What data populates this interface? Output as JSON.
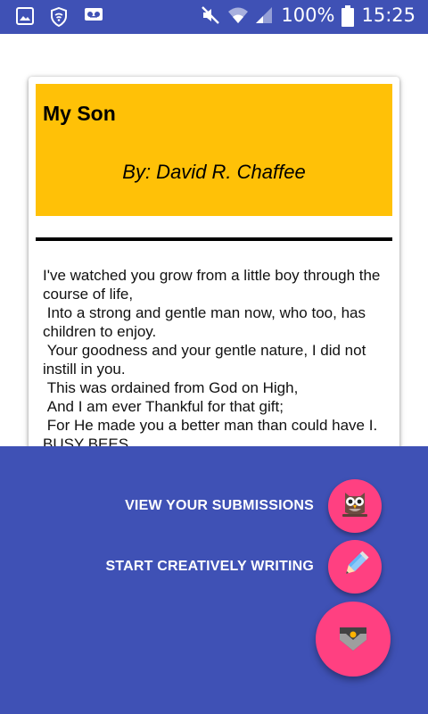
{
  "status_bar": {
    "battery_percent": "100%",
    "time": "15:25",
    "icons": [
      "image-icon",
      "vpn-shield-icon",
      "voicemail-icon",
      "mute-icon",
      "wifi-icon",
      "signal-icon",
      "battery-icon"
    ]
  },
  "poem": {
    "title": "My Son",
    "author": "By:  David R. Chaffee",
    "body": "I've watched you grow from a little boy through the course of life,\n Into a strong and gentle man now, who too, has children to enjoy.\n Your goodness and your gentle nature, I did not instill in you.\n This was ordained from God on High,\n And I am ever Thankful for that gift;\n For He made you a better man than could have I.\nBUSY BEES"
  },
  "fab_menu": {
    "view_submissions_label": "VIEW YOUR SUBMISSIONS",
    "start_writing_label": "START CREATIVELY WRITING"
  },
  "colors": {
    "primary": "#3f51b5",
    "accent": "#ff4081",
    "header": "#ffc107"
  }
}
